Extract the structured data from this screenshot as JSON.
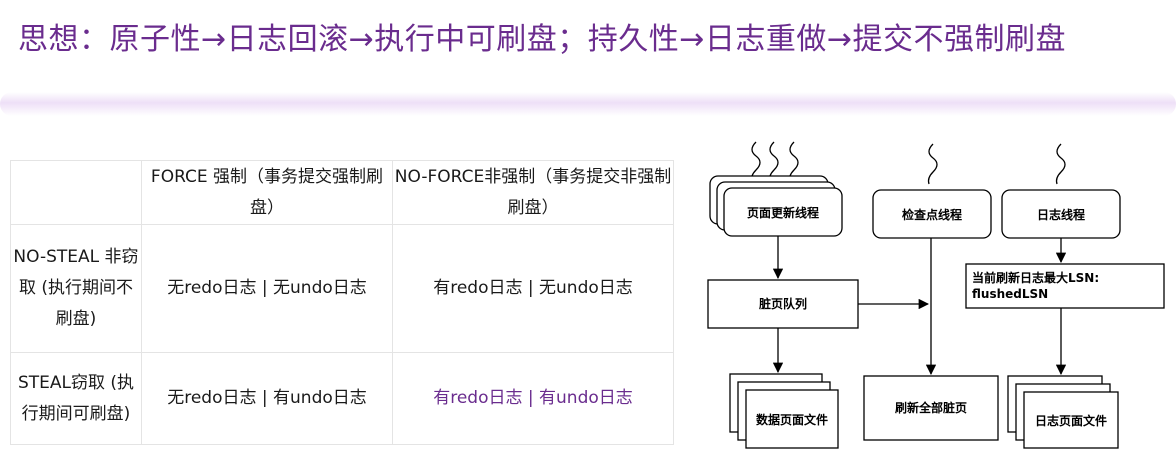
{
  "title": "思想：原子性→日志回滚→执行中可刷盘；持久性→日志重做→提交不强制刷盘",
  "table": {
    "headers": [
      "",
      "FORCE 强制（事务提交强制刷盘）",
      "NO-FORCE非强制（事务提交非强制刷盘）"
    ],
    "rows": [
      {
        "label": "NO-STEAL 非窃取 (执行期间不刷盘)",
        "force": "无redo日志 | 无undo日志",
        "noforce": "有redo日志 | 无undo日志"
      },
      {
        "label": "STEAL窃取 (执行期间可刷盘)",
        "force": "无redo日志 | 有undo日志",
        "noforce": "有redo日志 | 有undo日志"
      }
    ]
  },
  "diagram": {
    "page_update_thread": "页面更新线程",
    "checkpoint_thread": "检查点线程",
    "log_thread": "日志线程",
    "dirty_page_queue": "脏页队列",
    "flushed_lsn_line1": "当前刷新日志最大LSN:",
    "flushed_lsn_line2": "flushedLSN",
    "data_page_file": "数据页面文件",
    "flush_all_dirty": "刷新全部脏页",
    "log_page_file": "日志页面文件"
  },
  "colors": {
    "title": "#6a2c8e",
    "highlight": "#6a2c8e"
  }
}
